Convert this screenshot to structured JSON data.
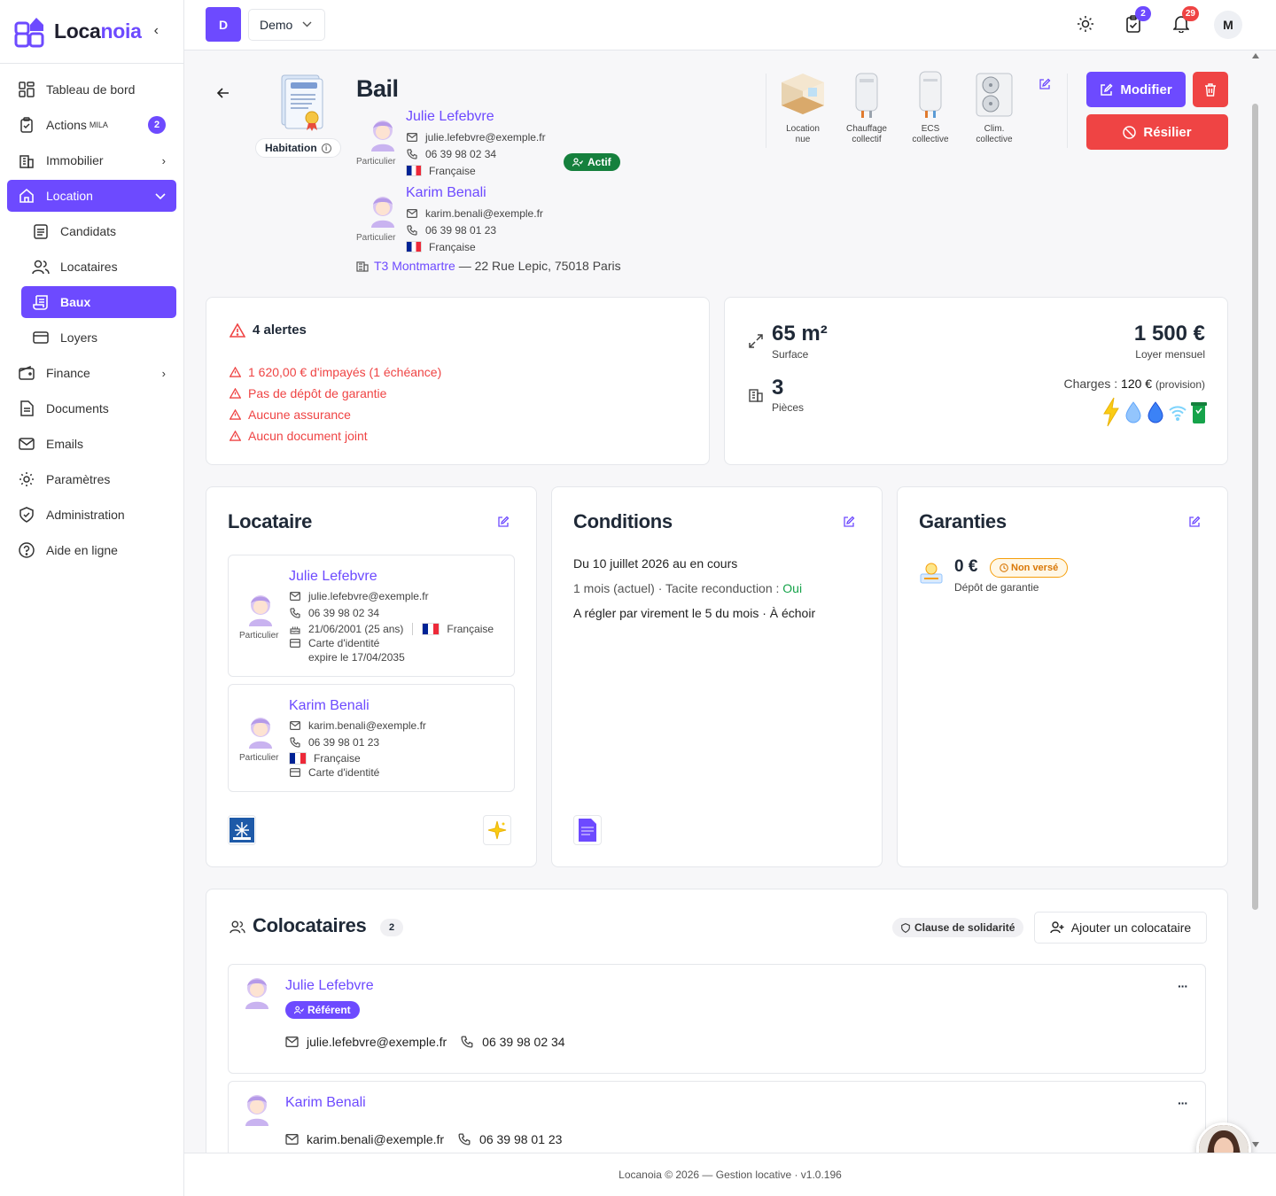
{
  "app": {
    "logo_text_a": "Loca",
    "logo_text_b": "noia",
    "collapse_glyph": "‹"
  },
  "sidebar": {
    "items": [
      {
        "label": "Tableau de bord",
        "icon": "dashboard-icon"
      },
      {
        "label": "Actions",
        "sup": "MILA",
        "badge": "2",
        "icon": "clipboard-icon"
      },
      {
        "label": "Immobilier",
        "icon": "building-icon",
        "chevron": "›"
      },
      {
        "label": "Location",
        "icon": "home-icon",
        "chevron": "⌄",
        "active": true
      },
      {
        "label": "Candidats",
        "icon": "clipboard-list-icon",
        "sub": true
      },
      {
        "label": "Locataires",
        "icon": "users-icon",
        "sub": true
      },
      {
        "label": "Baux",
        "icon": "scroll-icon",
        "sub": true,
        "active": true
      },
      {
        "label": "Loyers",
        "icon": "card-icon",
        "sub": true
      },
      {
        "label": "Finance",
        "icon": "wallet-icon",
        "chevron": "›"
      },
      {
        "label": "Documents",
        "icon": "document-icon"
      },
      {
        "label": "Emails",
        "icon": "mail-icon"
      },
      {
        "label": "Paramètres",
        "icon": "gear-icon"
      },
      {
        "label": "Administration",
        "icon": "shield-icon"
      },
      {
        "label": "Aide en ligne",
        "icon": "help-icon"
      }
    ]
  },
  "topbar": {
    "org_initial": "D",
    "org_name": "Demo",
    "tasks_badge": "2",
    "notif_badge": "29",
    "user_initial": "M"
  },
  "colors": {
    "accent": "#6d4aff",
    "danger": "#ef4444",
    "success": "#16a34a",
    "warning": "#f59e0b"
  },
  "header": {
    "title": "Bail",
    "type_label": "Habitation",
    "status": "Actif",
    "tenants": [
      {
        "name": "Julie Lefebvre",
        "email": "julie.lefebvre@exemple.fr",
        "phone": "06 39 98 02 34",
        "nationality": "Française",
        "kind": "Particulier"
      },
      {
        "name": "Karim Benali",
        "email": "karim.benali@exemple.fr",
        "phone": "06 39 98 01 23",
        "nationality": "Française",
        "kind": "Particulier"
      }
    ],
    "property_link": "T3 Montmartre",
    "property_address": "— 22 Rue Lepic, 75018 Paris",
    "features": [
      {
        "line1": "Location",
        "line2": "nue"
      },
      {
        "line1": "Chauffage",
        "line2": "collectif"
      },
      {
        "line1": "ECS",
        "line2": "collective"
      },
      {
        "line1": "Clim.",
        "line2": "collective"
      }
    ],
    "modify_label": "Modifier",
    "terminate_label": "Résilier"
  },
  "alerts": {
    "title": "4 alertes",
    "items": [
      "1 620,00 € d'impayés (1 échéance)",
      "Pas de dépôt de garantie",
      "Aucune assurance",
      "Aucun document joint"
    ]
  },
  "summary": {
    "surface_value": "65 m²",
    "surface_label": "Surface",
    "rooms_value": "3",
    "rooms_label": "Pièces",
    "rent_value": "1 500 €",
    "rent_label": "Loyer mensuel",
    "charges_label": "Charges :",
    "charges_value": "120 €",
    "charges_note": "(provision)"
  },
  "locataire_card": {
    "title": "Locataire",
    "persons": [
      {
        "name": "Julie Lefebvre",
        "email": "julie.lefebvre@exemple.fr",
        "phone": "06 39 98 02 34",
        "birth": "21/06/2001 (25 ans)",
        "nationality": "Française",
        "id_doc": "Carte d'identité",
        "id_expiry": "expire le 17/04/2035",
        "kind": "Particulier"
      },
      {
        "name": "Karim Benali",
        "email": "karim.benali@exemple.fr",
        "phone": "06 39 98 01 23",
        "nationality": "Française",
        "id_doc": "Carte d'identité",
        "kind": "Particulier"
      }
    ]
  },
  "conditions": {
    "title": "Conditions",
    "line1": "Du 10 juillet 2026 au en cours",
    "line2a": "1 mois (actuel) · Tacite reconduction :",
    "line2b": "Oui",
    "line3": "A régler par virement le 5 du mois · À échoir"
  },
  "garanties": {
    "title": "Garanties",
    "amount": "0 €",
    "status": "Non versé",
    "label": "Dépôt de garantie"
  },
  "colocataires": {
    "title": "Colocataires",
    "count": "2",
    "solidarity_label": "Clause de solidarité",
    "add_label": "Ajouter un colocataire",
    "items": [
      {
        "name": "Julie Lefebvre",
        "badge": "Référent",
        "email": "julie.lefebvre@exemple.fr",
        "phone": "06 39 98 02 34"
      },
      {
        "name": "Karim Benali",
        "email": "karim.benali@exemple.fr",
        "phone": "06 39 98 01 23"
      }
    ],
    "menu_glyph": "···"
  },
  "footer": {
    "text": "Locanoia © 2026 — Gestion locative · v1.0.196"
  }
}
